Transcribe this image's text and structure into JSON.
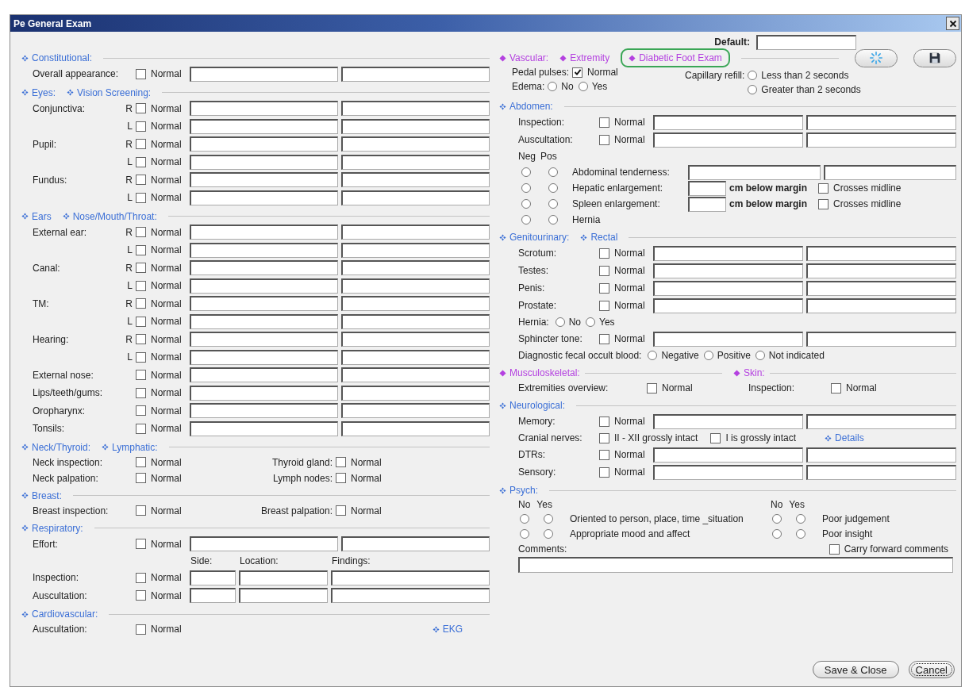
{
  "window": {
    "title": "Pe General Exam"
  },
  "default_field": {
    "label": "Default:"
  },
  "left_column": [
    {
      "headers": [
        {
          "label": "Constitutional:",
          "kind": "cross",
          "color": "#3b6fd6"
        }
      ],
      "rows": [
        {
          "kind": "fields2",
          "label": "Overall appearance:",
          "check": {
            "label": "Normal",
            "checked": false
          }
        }
      ]
    },
    {
      "headers": [
        {
          "label": "Eyes:",
          "kind": "cross",
          "color": "#3b6fd6"
        },
        {
          "label": "Vision Screening:",
          "kind": "cross",
          "color": "#3b6fd6"
        }
      ],
      "rows": [
        {
          "kind": "fields2",
          "label": "Conjunctiva:",
          "side": "R",
          "check": {
            "label": "Normal",
            "checked": false
          }
        },
        {
          "kind": "fields2",
          "side": "L",
          "check": {
            "label": "Normal",
            "checked": false
          }
        },
        {
          "kind": "fields2",
          "label": "Pupil:",
          "side": "R",
          "check": {
            "label": "Normal",
            "checked": false
          }
        },
        {
          "kind": "fields2",
          "side": "L",
          "check": {
            "label": "Normal",
            "checked": false
          }
        },
        {
          "kind": "fields2",
          "label": "Fundus:",
          "side": "R",
          "check": {
            "label": "Normal",
            "checked": false
          }
        },
        {
          "kind": "fields2",
          "side": "L",
          "check": {
            "label": "Normal",
            "checked": false
          }
        }
      ]
    },
    {
      "headers": [
        {
          "label": "Ears",
          "kind": "cross",
          "color": "#3b6fd6"
        },
        {
          "label": "Nose/Mouth/Throat:",
          "kind": "cross",
          "color": "#3b6fd6"
        }
      ],
      "rows": [
        {
          "kind": "fields2",
          "label": "External ear:",
          "side": "R",
          "check": {
            "label": "Normal",
            "checked": false
          }
        },
        {
          "kind": "fields2",
          "side": "L",
          "check": {
            "label": "Normal",
            "checked": false
          }
        },
        {
          "kind": "fields2",
          "label": "Canal:",
          "side": "R",
          "check": {
            "label": "Normal",
            "checked": false
          }
        },
        {
          "kind": "fields2",
          "side": "L",
          "check": {
            "label": "Normal",
            "checked": false
          }
        },
        {
          "kind": "fields2",
          "label": "TM:",
          "side": "R",
          "check": {
            "label": "Normal",
            "checked": false
          }
        },
        {
          "kind": "fields2",
          "side": "L",
          "check": {
            "label": "Normal",
            "checked": false
          }
        },
        {
          "kind": "fields2",
          "label": "Hearing:",
          "side": "R",
          "check": {
            "label": "Normal",
            "checked": false
          }
        },
        {
          "kind": "fields2",
          "side": "L",
          "check": {
            "label": "Normal",
            "checked": false
          }
        },
        {
          "kind": "fields2",
          "label": "External nose:",
          "check": {
            "label": "Normal",
            "checked": false
          }
        },
        {
          "kind": "fields2",
          "label": "Lips/teeth/gums:",
          "check": {
            "label": "Normal",
            "checked": false
          }
        },
        {
          "kind": "fields2",
          "label": "Oropharynx:",
          "check": {
            "label": "Normal",
            "checked": false
          }
        },
        {
          "kind": "fields2",
          "label": "Tonsils:",
          "check": {
            "label": "Normal",
            "checked": false
          }
        }
      ]
    },
    {
      "headers": [
        {
          "label": "Neck/Thyroid:",
          "kind": "cross",
          "color": "#3b6fd6"
        },
        {
          "label": "Lymphatic:",
          "kind": "cross",
          "color": "#3b6fd6"
        }
      ],
      "rows": [
        {
          "kind": "pair",
          "items": [
            {
              "label": "Neck inspection:",
              "check": {
                "label": "Normal",
                "checked": false
              }
            },
            {
              "label": "Thyroid gland:",
              "check": {
                "label": "Normal",
                "checked": false
              }
            }
          ]
        },
        {
          "kind": "pair",
          "items": [
            {
              "label": "Neck palpation:",
              "check": {
                "label": "Normal",
                "checked": false
              }
            },
            {
              "label": "Lymph nodes:",
              "check": {
                "label": "Normal",
                "checked": false
              }
            }
          ]
        }
      ]
    },
    {
      "headers": [
        {
          "label": "Breast:",
          "kind": "cross",
          "color": "#3b6fd6"
        }
      ],
      "rows": [
        {
          "kind": "pair",
          "items": [
            {
              "label": "Breast inspection:",
              "check": {
                "label": "Normal",
                "checked": false
              }
            },
            {
              "label": "Breast palpation:",
              "check": {
                "label": "Normal",
                "checked": false
              }
            }
          ]
        }
      ]
    },
    {
      "headers": [
        {
          "label": "Respiratory:",
          "kind": "cross",
          "color": "#3b6fd6"
        }
      ],
      "rows": [
        {
          "kind": "fields2",
          "label": "Effort:",
          "check": {
            "label": "Normal",
            "checked": false
          }
        },
        {
          "kind": "column_labels",
          "labels": [
            "Side:",
            "Location:",
            "Findings:"
          ]
        },
        {
          "kind": "fields3",
          "label": "Inspection:",
          "check": {
            "label": "Normal",
            "checked": false
          }
        },
        {
          "kind": "fields3",
          "label": "Auscultation:",
          "check": {
            "label": "Normal",
            "checked": false
          }
        }
      ]
    },
    {
      "headers": [
        {
          "label": "Cardiovascular:",
          "kind": "cross",
          "color": "#3b6fd6"
        }
      ],
      "rows": [
        {
          "kind": "check",
          "label": "Auscultation:",
          "check": {
            "label": "Normal",
            "checked": false
          },
          "link": {
            "label": "EKG"
          }
        }
      ]
    }
  ],
  "right_column": [
    {
      "headers": [
        {
          "label": "Vascular:",
          "kind": "diamond",
          "color": "#b441e0",
          "highlighted": false
        },
        {
          "label": "Extremity",
          "kind": "diamond",
          "color": "#b441e0",
          "highlighted": false
        },
        {
          "label": "Diabetic Foot Exam",
          "kind": "diamond",
          "color": "#b441e0",
          "highlighted": true
        }
      ],
      "tools": [
        {
          "kind": "refresh"
        },
        {
          "kind": "save"
        }
      ],
      "rows": [
        {
          "kind": "vascular",
          "left": [
            {
              "kind": "check",
              "label": "Pedal pulses:",
              "check": {
                "label": "Normal",
                "checked": true
              }
            },
            {
              "kind": "radios",
              "label": "Edema:",
              "options": [
                {
                  "label": "No",
                  "selected": false
                },
                {
                  "label": "Yes",
                  "selected": false
                }
              ]
            }
          ],
          "right": {
            "label": "Capillary refill:",
            "options": [
              {
                "label": "Less than 2 seconds",
                "selected": false
              },
              {
                "label": "Greater than 2 seconds",
                "selected": false
              }
            ]
          }
        }
      ]
    },
    {
      "headers": [
        {
          "label": "Abdomen:",
          "kind": "cross",
          "color": "#3b6fd6"
        }
      ],
      "rows": [
        {
          "kind": "fields2",
          "label": "Inspection:",
          "check": {
            "label": "Normal",
            "checked": false
          }
        },
        {
          "kind": "fields2",
          "label": "Auscultation:",
          "check": {
            "label": "Normal",
            "checked": false
          }
        },
        {
          "kind": "negpos_header",
          "labels": [
            "Neg",
            "Pos"
          ]
        },
        {
          "kind": "negpos_fields",
          "label": "Abdominal tenderness:",
          "options": [
            {
              "selected": false
            },
            {
              "selected": false
            }
          ]
        },
        {
          "kind": "negpos_margin",
          "label": "Hepatic enlargement:",
          "unit": "cm below margin",
          "check": {
            "label": "Crosses midline",
            "checked": false
          },
          "options": [
            {
              "selected": false
            },
            {
              "selected": false
            }
          ]
        },
        {
          "kind": "negpos_margin",
          "label": "Spleen enlargement:",
          "unit": "cm below margin",
          "check": {
            "label": "Crosses midline",
            "checked": false
          },
          "options": [
            {
              "selected": false
            },
            {
              "selected": false
            }
          ]
        },
        {
          "kind": "negpos",
          "label": "Hernia",
          "options": [
            {
              "selected": false
            },
            {
              "selected": false
            }
          ]
        }
      ]
    },
    {
      "headers": [
        {
          "label": "Genitourinary:",
          "kind": "cross",
          "color": "#3b6fd6"
        },
        {
          "label": "Rectal",
          "kind": "cross",
          "color": "#3b6fd6"
        }
      ],
      "rows": [
        {
          "kind": "fields2",
          "label": "Scrotum:",
          "check": {
            "label": "Normal",
            "checked": false
          }
        },
        {
          "kind": "fields2",
          "label": "Testes:",
          "check": {
            "label": "Normal",
            "checked": false
          }
        },
        {
          "kind": "fields2",
          "label": "Penis:",
          "check": {
            "label": "Normal",
            "checked": false
          }
        },
        {
          "kind": "fields2",
          "label": "Prostate:",
          "check": {
            "label": "Normal",
            "checked": false
          }
        },
        {
          "kind": "radios",
          "label": "Hernia:",
          "options": [
            {
              "label": "No",
              "selected": false
            },
            {
              "label": "Yes",
              "selected": false
            }
          ]
        },
        {
          "kind": "fields2",
          "label": "Sphincter tone:",
          "check": {
            "label": "Normal",
            "checked": false
          }
        },
        {
          "kind": "radios",
          "label": "Diagnostic fecal occult blood:",
          "options": [
            {
              "label": "Negative",
              "selected": false
            },
            {
              "label": "Positive",
              "selected": false
            },
            {
              "label": "Not indicated",
              "selected": false
            }
          ]
        }
      ]
    },
    {
      "headers": [
        {
          "label": "Musculoskeletal:",
          "kind": "diamond",
          "color": "#b441e0",
          "split": true
        },
        {
          "label": "Skin:",
          "kind": "diamond",
          "color": "#b441e0",
          "split": true
        }
      ],
      "rows": [
        {
          "kind": "pair",
          "items": [
            {
              "label": "Extremities overview:",
              "check": {
                "label": "Normal",
                "checked": false
              }
            },
            {
              "label": "Inspection:",
              "check": {
                "label": "Normal",
                "checked": false
              }
            }
          ]
        }
      ]
    },
    {
      "headers": [
        {
          "label": "Neurological:",
          "kind": "cross",
          "color": "#3b6fd6"
        }
      ],
      "rows": [
        {
          "kind": "fields2",
          "label": "Memory:",
          "check": {
            "label": "Normal",
            "checked": false
          }
        },
        {
          "kind": "multi_check",
          "label": "Cranial nerves:",
          "checks": [
            {
              "label": "II - XII grossly intact",
              "checked": false
            },
            {
              "label": "I is grossly intact",
              "checked": false
            }
          ],
          "link": {
            "label": "Details"
          }
        },
        {
          "kind": "fields2",
          "label": "DTRs:",
          "check": {
            "label": "Normal",
            "checked": false
          }
        },
        {
          "kind": "fields2",
          "label": "Sensory:",
          "check": {
            "label": "Normal",
            "checked": false
          }
        }
      ]
    },
    {
      "headers": [
        {
          "label": "Psych:",
          "kind": "cross",
          "color": "#3b6fd6"
        }
      ],
      "rows": [
        {
          "kind": "psych",
          "groups": [
            {
              "headers": [
                "No",
                "Yes"
              ],
              "items": [
                {
                  "label": "Oriented to person, place, time _situation",
                  "options": [
                    {
                      "selected": false
                    },
                    {
                      "selected": false
                    }
                  ]
                },
                {
                  "label": "Appropriate mood and affect",
                  "options": [
                    {
                      "selected": false
                    },
                    {
                      "selected": false
                    }
                  ]
                }
              ]
            },
            {
              "headers": [
                "No",
                "Yes"
              ],
              "items": [
                {
                  "label": "Poor judgement",
                  "options": [
                    {
                      "selected": false
                    },
                    {
                      "selected": false
                    }
                  ]
                },
                {
                  "label": "Poor insight",
                  "options": [
                    {
                      "selected": false
                    },
                    {
                      "selected": false
                    }
                  ]
                }
              ]
            }
          ]
        },
        {
          "kind": "comments",
          "label": "Comments:",
          "check": {
            "label": "Carry forward comments",
            "checked": false
          }
        }
      ]
    }
  ],
  "buttons": [
    {
      "label": "Save & Close",
      "focused": false
    },
    {
      "label": "Cancel",
      "focused": true
    }
  ]
}
